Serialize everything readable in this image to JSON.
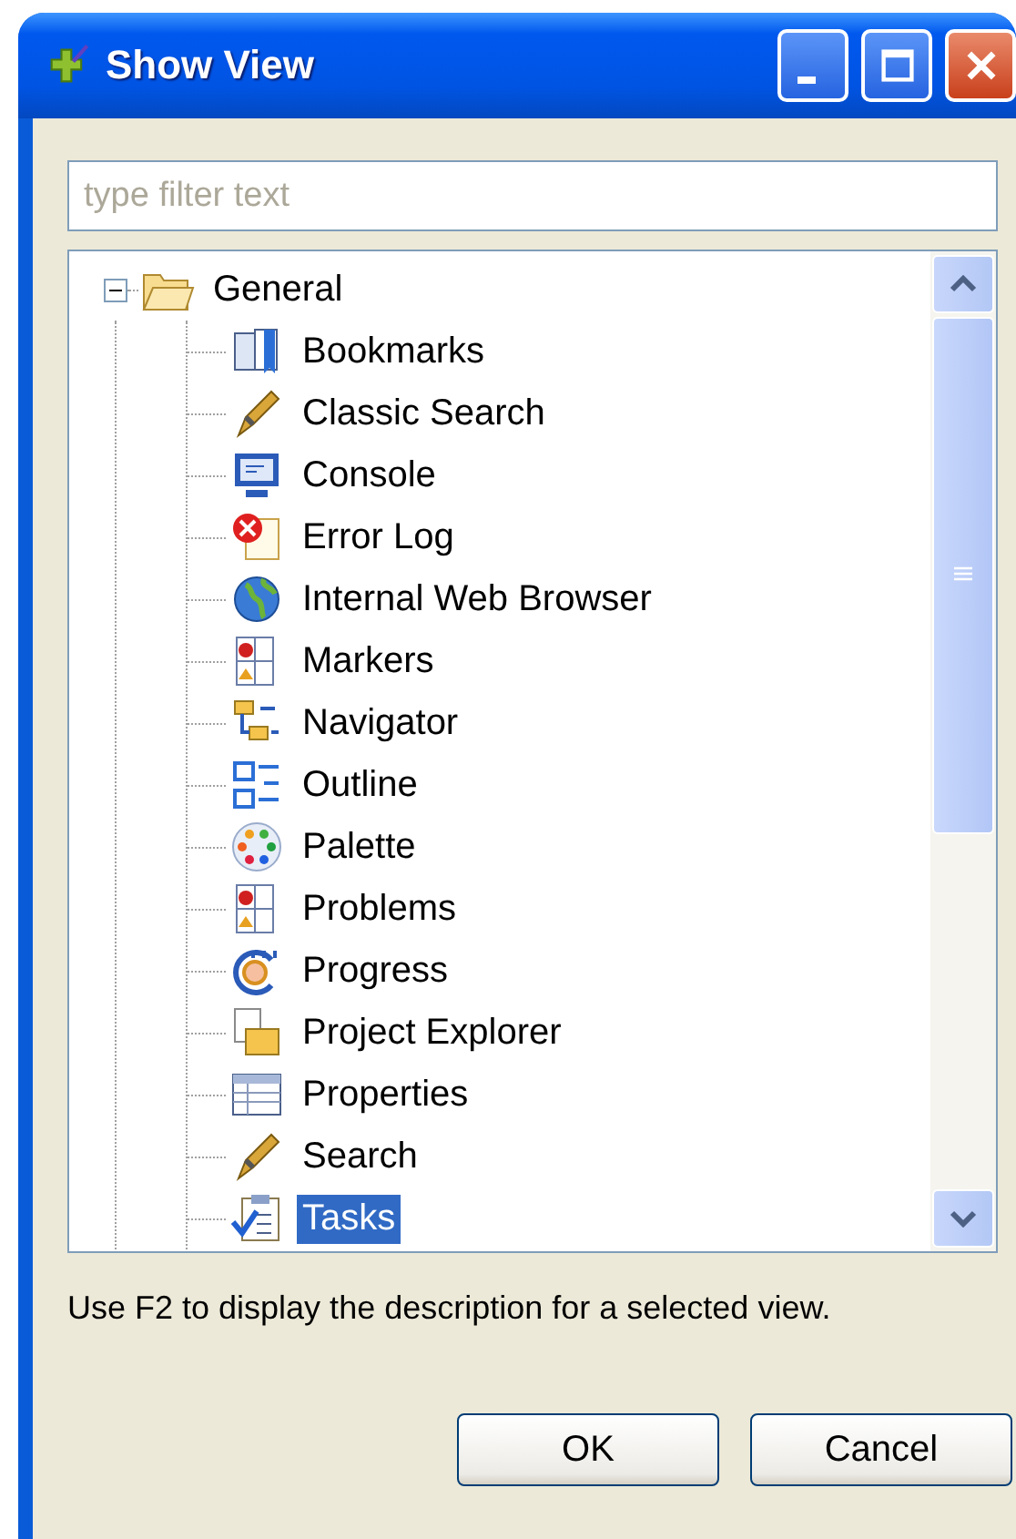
{
  "window": {
    "title": "Show View"
  },
  "filter": {
    "placeholder": "type filter text"
  },
  "tree": {
    "items": [
      {
        "label": "General",
        "expanded": true,
        "selected": false,
        "children": [
          {
            "label": "Bookmarks",
            "selected": false
          },
          {
            "label": "Classic Search",
            "selected": false
          },
          {
            "label": "Console",
            "selected": false
          },
          {
            "label": "Error Log",
            "selected": false
          },
          {
            "label": "Internal Web Browser",
            "selected": false
          },
          {
            "label": "Markers",
            "selected": false
          },
          {
            "label": "Navigator",
            "selected": false
          },
          {
            "label": "Outline",
            "selected": false
          },
          {
            "label": "Palette",
            "selected": false
          },
          {
            "label": "Problems",
            "selected": false
          },
          {
            "label": "Progress",
            "selected": false
          },
          {
            "label": "Project Explorer",
            "selected": false
          },
          {
            "label": "Properties",
            "selected": false
          },
          {
            "label": "Search",
            "selected": false
          },
          {
            "label": "Tasks",
            "selected": true
          }
        ]
      }
    ]
  },
  "description": "Use F2 to display the description for a selected view.",
  "buttons": [
    "OK",
    "Cancel"
  ]
}
